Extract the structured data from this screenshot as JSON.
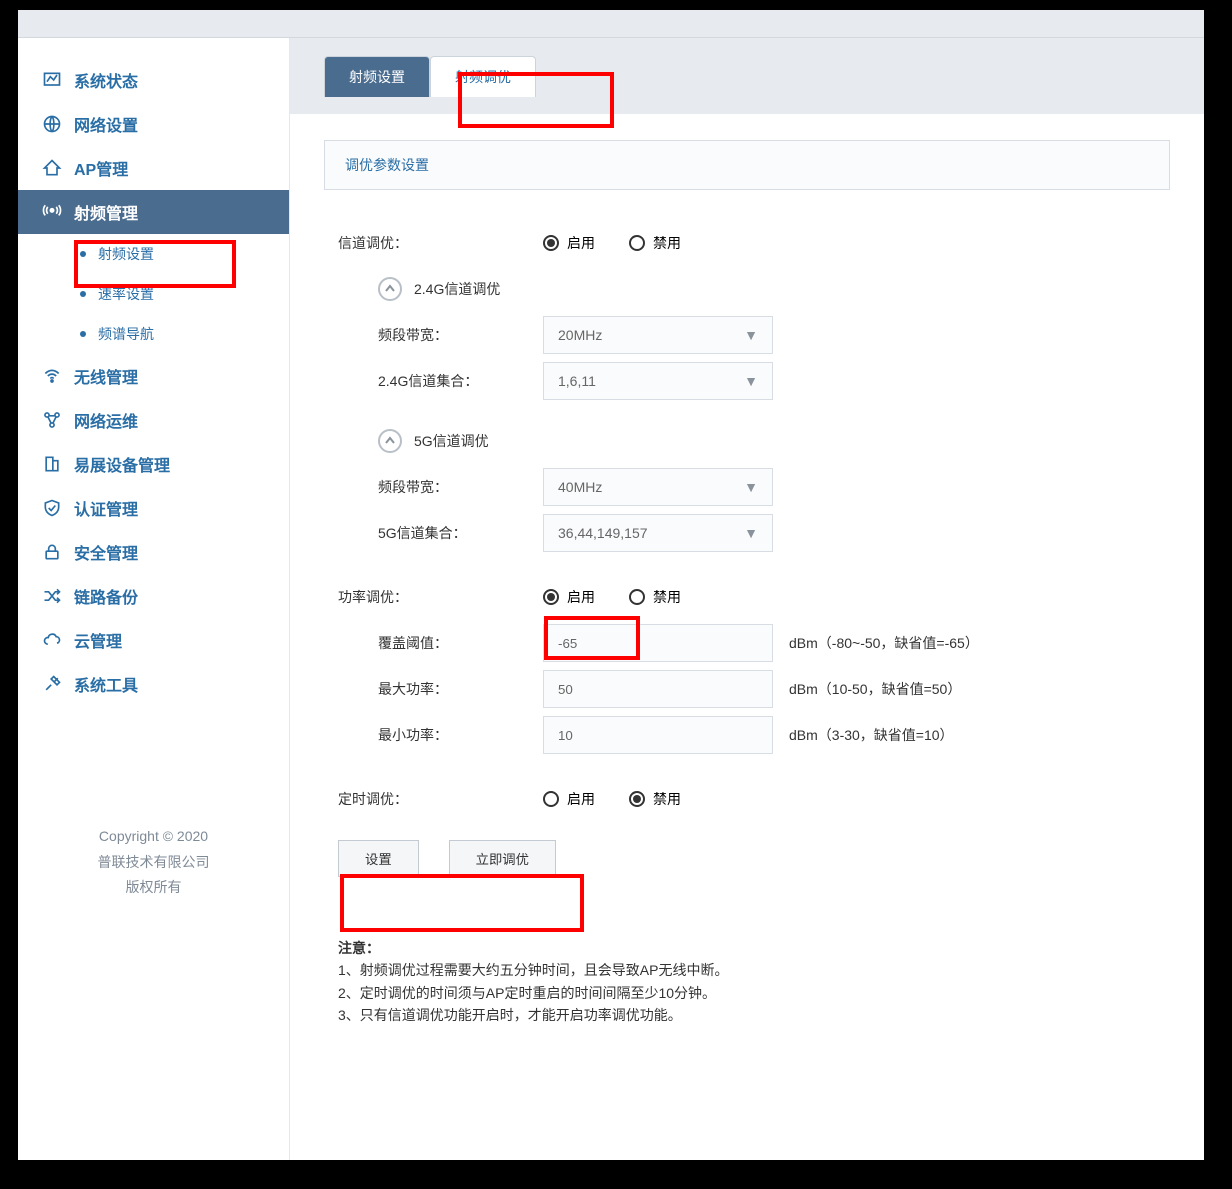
{
  "sidebar": {
    "items": [
      {
        "label": "系统状态",
        "icon": "chart-line-icon"
      },
      {
        "label": "网络设置",
        "icon": "globe-icon"
      },
      {
        "label": "AP管理",
        "icon": "ap-icon"
      },
      {
        "label": "射频管理",
        "icon": "antenna-icon",
        "active": true
      },
      {
        "label": "无线管理",
        "icon": "wifi-icon"
      },
      {
        "label": "网络运维",
        "icon": "nodes-icon"
      },
      {
        "label": "易展设备管理",
        "icon": "device-icon"
      },
      {
        "label": "认证管理",
        "icon": "shield-check-icon"
      },
      {
        "label": "安全管理",
        "icon": "lock-icon"
      },
      {
        "label": "链路备份",
        "icon": "shuffle-icon"
      },
      {
        "label": "云管理",
        "icon": "cloud-icon"
      },
      {
        "label": "系统工具",
        "icon": "tools-icon"
      }
    ],
    "submenu": {
      "items": [
        {
          "label": "射频设置",
          "active": true
        },
        {
          "label": "速率设置"
        },
        {
          "label": "频谱导航"
        }
      ]
    }
  },
  "footer": {
    "line1": "Copyright © 2020",
    "line2": "普联技术有限公司",
    "line3": "版权所有"
  },
  "tabs": {
    "inactive": "射频设置",
    "active": "射频调优"
  },
  "panel": {
    "title": "调优参数设置",
    "channel_opt_label": "信道调优：",
    "enable_label": "启用",
    "disable_label": "禁用",
    "sec24_title": "2.4G信道调优",
    "sec5_title": "5G信道调优",
    "bandwidth_label": "频段带宽：",
    "bandwidth24_value": "20MHz",
    "channels24_label": "2.4G信道集合：",
    "channels24_value": "1,6,11",
    "bandwidth5_value": "40MHz",
    "channels5_label": "5G信道集合：",
    "channels5_value": "36,44,149,157",
    "power_opt_label": "功率调优：",
    "coverage_label": "覆盖阈值：",
    "coverage_value": "-65",
    "coverage_hint": "dBm（-80~-50，缺省值=-65）",
    "maxpower_label": "最大功率：",
    "maxpower_value": "50",
    "maxpower_hint": "dBm（10-50，缺省值=50）",
    "minpower_label": "最小功率：",
    "minpower_value": "10",
    "minpower_hint": "dBm（3-30，缺省值=10）",
    "timed_opt_label": "定时调优：",
    "btn_set": "设置",
    "btn_opt_now": "立即调优",
    "notes_title": "注意：",
    "note1": "1、射频调优过程需要大约五分钟时间，且会导致AP无线中断。",
    "note2": "2、定时调优的时间须与AP定时重启的时间间隔至少10分钟。",
    "note3": "3、只有信道调优功能开启时，才能开启功率调优功能。"
  }
}
